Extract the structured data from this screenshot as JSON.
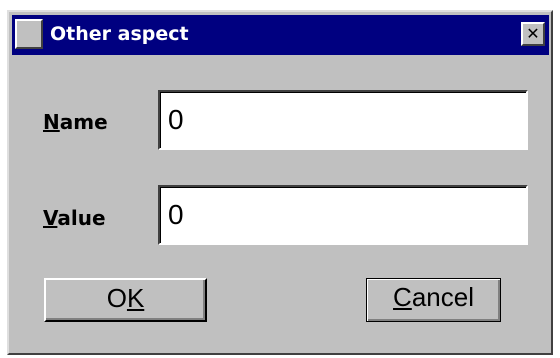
{
  "dialog": {
    "title": "Other aspect",
    "close_glyph": "✕",
    "name_label": {
      "mnemonic": "N",
      "rest": "ame"
    },
    "name_value": "0",
    "value_label": {
      "mnemonic": "V",
      "rest": "alue"
    },
    "value_value": "0",
    "ok_button": {
      "pre": "O",
      "mnemonic": "K"
    },
    "cancel_button": {
      "mnemonic": "C",
      "rest": "ancel"
    }
  },
  "colors": {
    "titlebar": "#000080",
    "face": "#c0c0c0"
  },
  "icons": {
    "app": "app-icon",
    "close": "close-icon"
  }
}
